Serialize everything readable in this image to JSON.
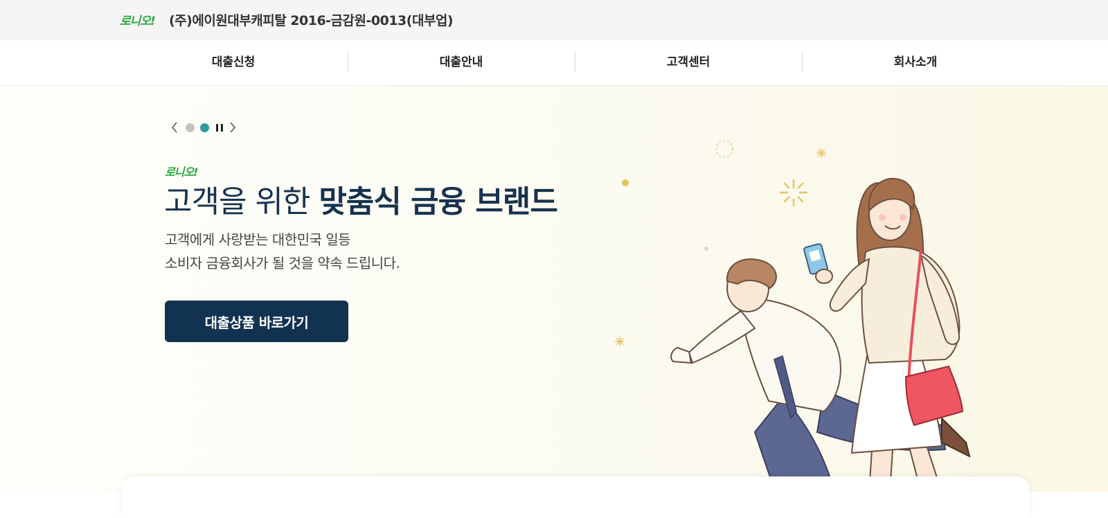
{
  "topbar": {
    "logo_text": "로니오!",
    "company_line": "(주)에이원대부캐피탈 2016-금감원-0013(대부업)"
  },
  "nav": {
    "items": [
      {
        "label": "대출신청"
      },
      {
        "label": "대출안내"
      },
      {
        "label": "고객센터"
      },
      {
        "label": "회사소개"
      }
    ]
  },
  "hero": {
    "slider": {
      "slide_count": 2,
      "active_index": 1,
      "prev_icon": "chevron-left-icon",
      "next_icon": "chevron-right-icon",
      "pause_icon": "pause-icon"
    },
    "logo_text": "로니오!",
    "headline_light": "고객을 위한 ",
    "headline_bold": "맞춤식 금융 브랜드",
    "sub_line1": "고객에게 사랑받는 대한민국 일등",
    "sub_line2": "소비자 금융회사가 될 것을 약속 드립니다.",
    "cta_label": "대출상품 바로가기"
  },
  "colors": {
    "brand_green": "#2aa83e",
    "navy": "#123252",
    "dot_active": "#2c9aa0",
    "dot_inactive": "#c4c4c4"
  }
}
